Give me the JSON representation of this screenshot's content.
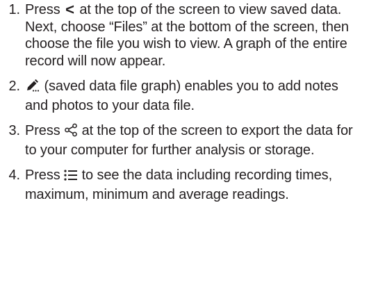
{
  "steps": [
    {
      "number": "1.",
      "before": "Press",
      "after": "at the top of the screen to view saved data. Next, choose “Files” at the bottom of the screen, then choose the file you wish to view. A graph of the entire record will now appear."
    },
    {
      "number": "2.",
      "after": "(saved data file graph) enables you to add notes and photos to your data file."
    },
    {
      "number": "3.",
      "before": "Press",
      "after": "at the top of the screen to export the data for to your computer for further analysis or storage."
    },
    {
      "number": "4.",
      "before": "Press",
      "after": "to see the data including recording times, maximum, minimum and average readings."
    }
  ],
  "icons": {
    "back": "chevron-left-icon",
    "edit": "pencil-note-icon",
    "share": "share-icon",
    "list": "list-icon"
  }
}
